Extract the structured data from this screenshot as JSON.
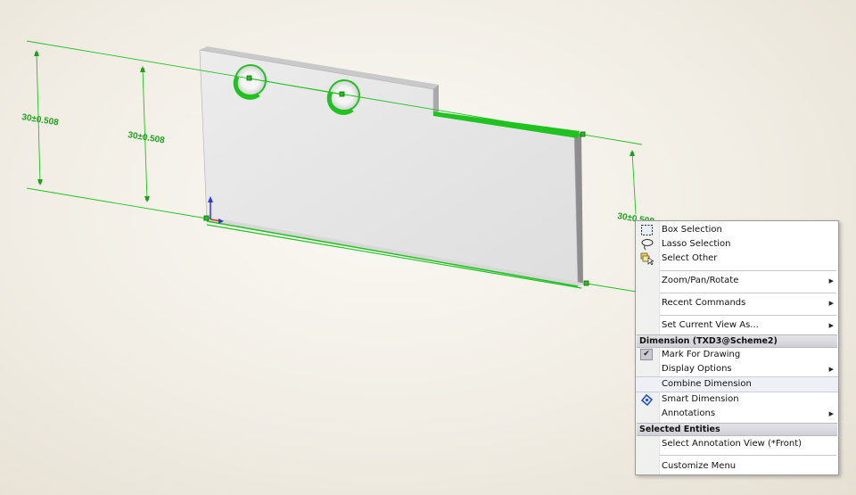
{
  "dimensions": {
    "left": "30±0.508",
    "middle": "30±0.508",
    "right": "30±0.508"
  },
  "colors": {
    "selection_green": "#1fc21f",
    "part_face": "#e8e8e8",
    "menu_header": "#d6d6dc"
  },
  "context_menu": {
    "items": {
      "box_selection": "Box Selection",
      "lasso_selection": "Lasso Selection",
      "select_other": "Select Other",
      "zoom_pan_rotate": "Zoom/Pan/Rotate",
      "recent_commands": "Recent Commands",
      "set_current_view": "Set Current View As..."
    },
    "dimension_header": "Dimension (TXD3@Scheme2)",
    "dimension_items": {
      "mark_for_drawing": "Mark For Drawing",
      "display_options": "Display Options",
      "combine_dimension": "Combine Dimension",
      "smart_dimension": "Smart Dimension",
      "annotations": "Annotations"
    },
    "selected_header": "Selected Entities",
    "selected_items": {
      "select_annotation_view": "Select Annotation View (*Front)",
      "customize_menu": "Customize Menu"
    },
    "icons": [
      "box-selection-icon",
      "lasso-icon",
      "select-other-icon",
      "checkmark-icon",
      "smart-dimension-icon"
    ]
  }
}
